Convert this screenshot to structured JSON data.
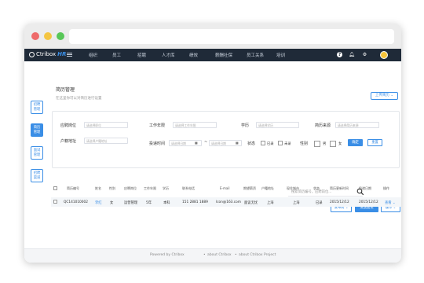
{
  "nav": {
    "brand": "Ctribox",
    "brand_suffix": "HR",
    "menu": [
      "组织",
      "员工",
      "招聘",
      "人才库",
      "绩效",
      "薪酬社保",
      "员工关系",
      "培训"
    ]
  },
  "sidebar": {
    "items": [
      {
        "label_1": "招聘",
        "label_2": "管理"
      },
      {
        "label_1": "简历",
        "label_2": "管理"
      },
      {
        "label_1": "面试",
        "label_2": "管理"
      },
      {
        "label_1": "招聘",
        "label_2": "渠道"
      }
    ]
  },
  "page": {
    "title": "简历管理",
    "subtitle": "在这里你可以对简历进行设置",
    "upload_label": "上传简历 ⌄"
  },
  "filters": {
    "position_label": "应聘岗位",
    "position_placeholder": "请选择职位",
    "work_years_label": "工作年限",
    "work_years_placeholder": "请选择工作年限",
    "education_label": "学历",
    "education_placeholder": "请选择学历",
    "source_label": "简历来源",
    "source_placeholder": "请选择简历来源",
    "hukou_label": "户籍地址",
    "hukou_placeholder": "请选择户籍地址",
    "date_label": "投递时间",
    "date_start": "请选择日期",
    "date_sep": "~",
    "date_end": "请选择日期",
    "status_label": "状态",
    "status_opt1": "已录",
    "status_opt2": "未录",
    "gender_label": "性别",
    "gender_opt1": "男",
    "gender_opt2": "女",
    "confirm_label": "确定",
    "reset_label": "重置"
  },
  "search": {
    "placeholder": "搜索简历编号，应聘岗位..."
  },
  "table_actions": {
    "batch_label": "发布简 ⌄",
    "invite_label": "发送面试",
    "more_label": "操作 ⌄"
  },
  "table": {
    "headers": [
      "简历编号",
      "姓名",
      "性别",
      "应聘岗位",
      "工作年限",
      "学历",
      "联系电话",
      "E-mail",
      "期望薪资",
      "户籍地址",
      "现住城市",
      "状态",
      "简历更新时间",
      "投递日期",
      "操作"
    ],
    "rows": [
      [
        "QC141010002",
        "李红",
        "女",
        "运营管理",
        "5年",
        "本科",
        "151 2881 1889",
        "lcon@163.com",
        "面议无忧",
        "上海",
        "上海",
        "已录",
        "2015/12/12",
        "2015/12/12",
        "查看 ⌄"
      ]
    ]
  },
  "footer": {
    "powered": "Powered by Ctribox",
    "about": "about Ctribox",
    "project": "about Ctribox  Project"
  },
  "colors": {
    "accent": "#3a8ee6",
    "nav_bg": "#1f2a38"
  }
}
